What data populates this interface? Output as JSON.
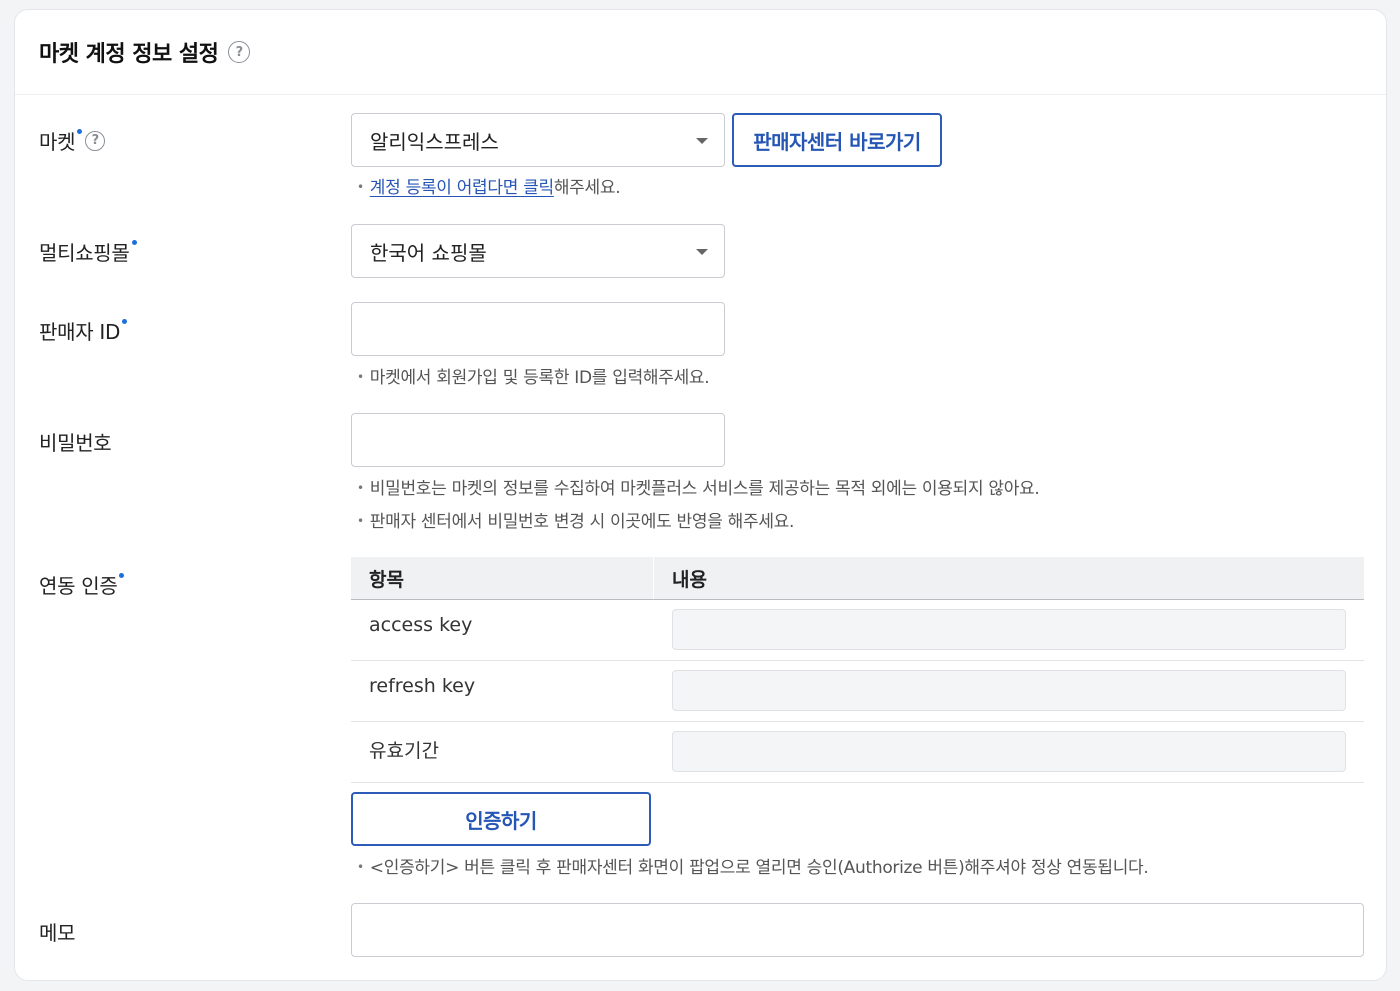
{
  "header": {
    "title": "마켓 계정 정보 설정",
    "help_glyph": "?"
  },
  "market": {
    "label": "마켓",
    "selected": "알리익스프레스",
    "seller_center_button": "판매자센터 바로가기",
    "hint_link": "계정 등록이 어렵다면 클릭",
    "hint_suffix": "해주세요."
  },
  "multi_mall": {
    "label": "멀티쇼핑몰",
    "selected": "한국어 쇼핑몰"
  },
  "seller_id": {
    "label": "판매자 ID",
    "value": "",
    "hint": "마켓에서 회원가입 및 등록한 ID를 입력해주세요."
  },
  "password": {
    "label": "비밀번호",
    "value": "",
    "hints": [
      "비밀번호는 마켓의 정보를 수집하여 마켓플러스 서비스를 제공하는 목적 외에는 이용되지 않아요.",
      "판매자 센터에서 비밀번호 변경 시 이곳에도 반영을 해주세요."
    ]
  },
  "auth": {
    "label": "연동 인증",
    "table": {
      "headers": [
        "항목",
        "내용"
      ],
      "rows": [
        {
          "key": "access key",
          "value": ""
        },
        {
          "key": "refresh key",
          "value": ""
        },
        {
          "key": "유효기간",
          "value": ""
        }
      ]
    },
    "button": "인증하기",
    "hint": "<인증하기> 버튼 클릭 후 판매자센터 화면이 팝업으로 열리면 승인(Authorize 버튼)해주셔야 정상 연동됩니다."
  },
  "memo": {
    "label": "메모",
    "value": ""
  },
  "colors": {
    "accent": "#2656b5",
    "required_dot": "#1e6fd9"
  }
}
